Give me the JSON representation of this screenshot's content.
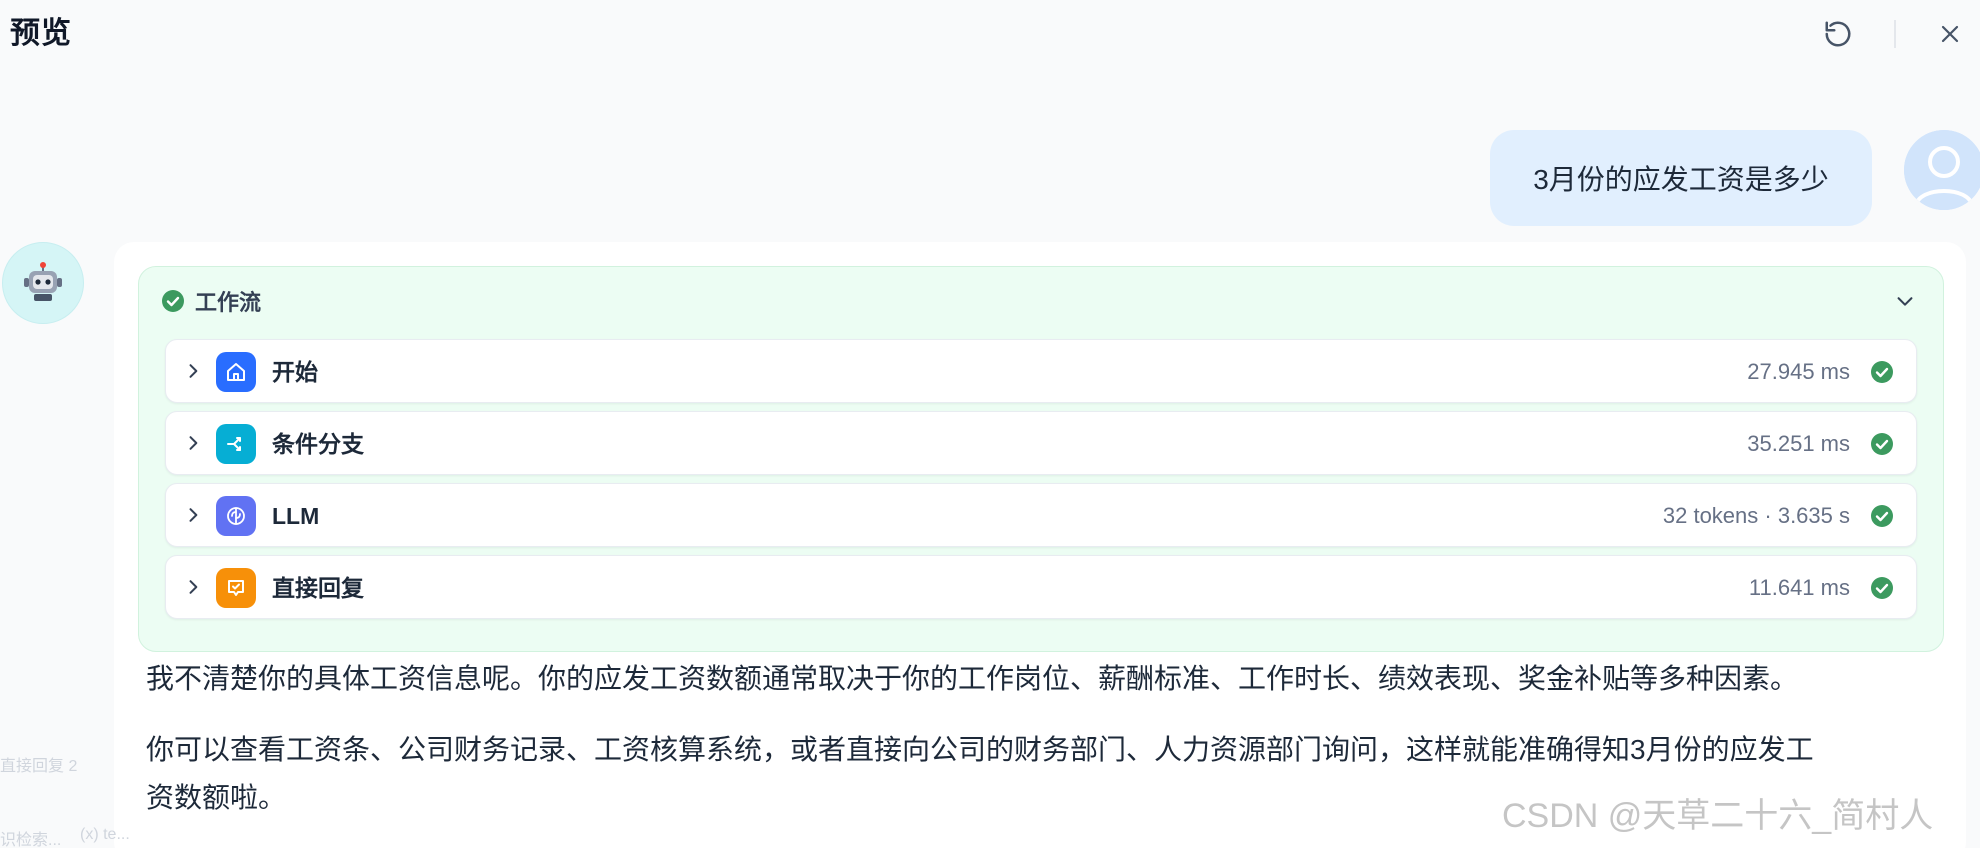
{
  "header": {
    "title": "预览",
    "refresh_icon": "refresh-icon",
    "close_icon": "close-icon"
  },
  "user_message": {
    "text": "3月份的应发工资是多少",
    "avatar_icon": "user-avatar-icon"
  },
  "bot": {
    "avatar_icon": "robot-icon"
  },
  "workflow": {
    "title": "工作流",
    "status": "success",
    "nodes": [
      {
        "label": "开始",
        "meta": "27.945 ms",
        "icon": "home-icon",
        "color": "#296dff"
      },
      {
        "label": "条件分支",
        "meta": "35.251 ms",
        "icon": "branch-icon",
        "color": "#06aed4"
      },
      {
        "label": "LLM",
        "meta": "32 tokens · 3.635 s",
        "icon": "brain-icon",
        "color": "#6172f3"
      },
      {
        "label": "直接回复",
        "meta": "11.641 ms",
        "icon": "reply-icon",
        "color": "#f79009"
      }
    ]
  },
  "answer": {
    "paragraph_1": "我不清楚你的具体工资信息呢。你的应发工资数额通常取决于你的工作岗位、薪酬标准、工作时长、绩效表现、奖金补贴等多种因素。",
    "paragraph_2_line_1": "你可以查看工资条、公司财务记录、工资核算系统，或者直接向公司的财务部门、人力资源部门询问，这样就能准确得知3月份的应发工",
    "paragraph_2_line_2": "资数额啦。"
  },
  "background_ghost": {
    "text_1": "直接回复 2",
    "text_2": "识检索...",
    "text_3": "(x) te..."
  },
  "watermark": "CSDN @天草二十六_简村人",
  "colors": {
    "success_green": "#3c9a5f",
    "user_bubble": "#e1effe",
    "workflow_bg": "#ecfdf3"
  }
}
